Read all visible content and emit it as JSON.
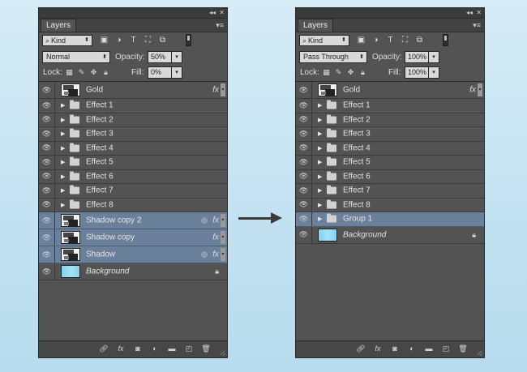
{
  "panels": [
    {
      "tab": "Layers",
      "kind": "Kind",
      "blend_mode": "Normal",
      "opacity_label": "Opacity:",
      "opacity": "50%",
      "lock_label": "Lock:",
      "fill_label": "Fill:",
      "fill": "0%",
      "layers": [
        {
          "name": "Gold",
          "type": "smart",
          "fx": true,
          "selected": false,
          "italic": false
        },
        {
          "name": "Effect 1",
          "type": "group",
          "selected": false
        },
        {
          "name": "Effect 2",
          "type": "group",
          "selected": false
        },
        {
          "name": "Effect 3",
          "type": "group",
          "selected": false
        },
        {
          "name": "Effect 4",
          "type": "group",
          "selected": false
        },
        {
          "name": "Effect 5",
          "type": "group",
          "selected": false
        },
        {
          "name": "Effect 6",
          "type": "group",
          "selected": false
        },
        {
          "name": "Effect 7",
          "type": "group",
          "selected": false
        },
        {
          "name": "Effect 8",
          "type": "group",
          "selected": false
        },
        {
          "name": "Shadow copy 2",
          "type": "smart",
          "fx": true,
          "filter_mark": true,
          "selected": true
        },
        {
          "name": "Shadow copy",
          "type": "smart",
          "fx": true,
          "selected": true
        },
        {
          "name": "Shadow",
          "type": "smart",
          "fx": true,
          "filter_mark": true,
          "selected": true
        },
        {
          "name": "Background",
          "type": "background",
          "selected": false,
          "italic": true,
          "locked": true
        }
      ]
    },
    {
      "tab": "Layers",
      "kind": "Kind",
      "blend_mode": "Pass Through",
      "opacity_label": "Opacity:",
      "opacity": "100%",
      "lock_label": "Lock:",
      "fill_label": "Fill:",
      "fill": "100%",
      "layers": [
        {
          "name": "Gold",
          "type": "smart",
          "fx": true,
          "selected": false
        },
        {
          "name": "Effect 1",
          "type": "group",
          "selected": false
        },
        {
          "name": "Effect 2",
          "type": "group",
          "selected": false
        },
        {
          "name": "Effect 3",
          "type": "group",
          "selected": false
        },
        {
          "name": "Effect 4",
          "type": "group",
          "selected": false
        },
        {
          "name": "Effect 5",
          "type": "group",
          "selected": false
        },
        {
          "name": "Effect 6",
          "type": "group",
          "selected": false
        },
        {
          "name": "Effect 7",
          "type": "group",
          "selected": false
        },
        {
          "name": "Effect 8",
          "type": "group",
          "selected": false
        },
        {
          "name": "Group 1",
          "type": "group",
          "selected": true
        },
        {
          "name": "Background",
          "type": "background",
          "selected": false,
          "italic": true,
          "locked": true
        }
      ]
    }
  ],
  "icons": {
    "eye": "visibility-eye-icon",
    "fx": "fx",
    "lock": "lock-icon"
  },
  "colors": {
    "panel_bg": "#535353",
    "selected_row": "#6b809b",
    "background_thumb": "#8fd9f1",
    "page_bg": "#c8e6f3"
  }
}
